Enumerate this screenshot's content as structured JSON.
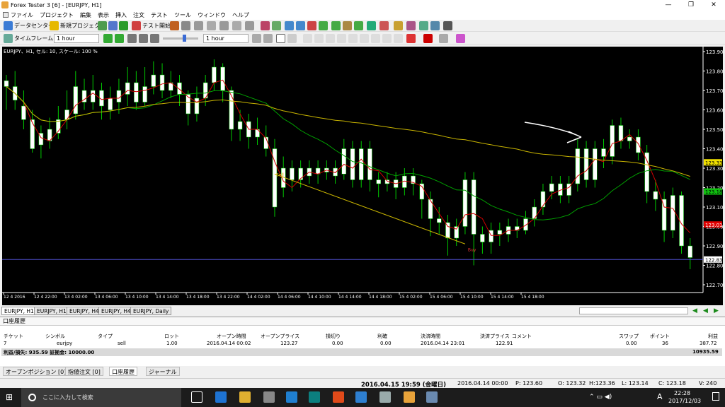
{
  "window": {
    "title": "Forex Tester 3  [6] - [EURJPY, H1]",
    "min": "—",
    "max": "❐",
    "close": "✕"
  },
  "menu": [
    "ファイル",
    "プロジェクト",
    "編集",
    "表示",
    "挿入",
    "注文",
    "テスト",
    "ツール",
    "ウィンドウ",
    "ヘルプ"
  ],
  "toolbar1": {
    "data_center": "データセンター",
    "new_project": "新規プロジェクト",
    "test_start": "テスト開始"
  },
  "toolbar2": {
    "timeframe_label": "タイムフレーム",
    "timeframe_value": "1 hour",
    "speed_value": "1 hour"
  },
  "chart": {
    "info": "EURJPY、H1, セル: 10, スケール: 100 %",
    "price_labels": [
      "123.90",
      "123.80",
      "123.70",
      "123.60",
      "123.50",
      "123.40",
      "123.30",
      "123.20",
      "123.10",
      "123.00",
      "122.90",
      "122.80",
      "122.70"
    ],
    "time_labels": [
      "12 4 2016",
      "12 4 22:00",
      "13 4 02:00",
      "13 4 06:00",
      "13 4 10:00",
      "13 4 14:00",
      "13 4 18:00",
      "13 4 22:00",
      "14 4 02:00",
      "14 4 06:00",
      "14 4 10:00",
      "14 4 14:00",
      "14 4 18:00",
      "15 4 02:00",
      "15 4 06:00",
      "15 4 10:00",
      "15 4 14:00",
      "15 4 18:00"
    ],
    "markers": {
      "yellow": "123.33",
      "green": "123.18",
      "red": "123.01",
      "current": "122.83"
    },
    "sell_label": "Sell",
    "buy_label": "Buy",
    "colors": {
      "background": "#000000",
      "candle": "#ffffff",
      "wick": "#00c800",
      "ma_fast": "#d00000",
      "ma_mid": "#00a000",
      "ma_slow": "#c8b400"
    }
  },
  "chart_tabs": [
    "EURJPY, H1",
    "EURJPY, H1",
    "EURJPY, H4",
    "EURJPY, H4",
    "EURJPY, Daily"
  ],
  "panel": {
    "title": "口座履歴",
    "headers": [
      "チケット",
      "シンボル",
      "タイプ",
      "ロット",
      "オープン時間",
      "オープンプライス",
      "損切り",
      "利確",
      "決済時間",
      "決済プライス",
      "コメント",
      "スワップ",
      "ポイント",
      "利益"
    ],
    "row": [
      "7",
      "eurjpy",
      "sell",
      "1.00",
      "2016.04.14 00:02",
      "123.27",
      "0.00",
      "0.00",
      "2016.04.14 23:01",
      "122.91",
      "",
      "0.00",
      "36",
      "387.72"
    ],
    "summary": "利益/損失: 935.59 証拠金: 10000.00",
    "total": "10935.59"
  },
  "panel_tabs": [
    "オープンポジション [0]",
    "指値注文 [0]",
    "口座履歴",
    "ジャーナル"
  ],
  "status": {
    "date": "2016.04.15 19:59 (金曜日)",
    "bar_time": "2016.04.14 00:00",
    "p": "P: 123.60",
    "o": "O: 123.32",
    "h": "H:123.36",
    "l": "L: 123.14",
    "c": "C: 123.18",
    "v": "V: 240"
  },
  "taskbar": {
    "search": "ここに入力して検索",
    "time": "22:28",
    "date": "2017/12/03",
    "ime": "A"
  }
}
